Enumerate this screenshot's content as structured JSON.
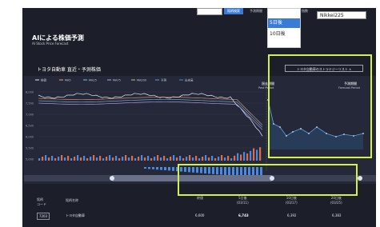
{
  "header": {
    "search_button": "銘柄検索",
    "nav_forecast": "予測期間",
    "nav_right": "指数",
    "ticker_value": "Nikkei225"
  },
  "dropdown": {
    "items": [
      "5日後",
      "10日後"
    ],
    "selected": "5日後"
  },
  "page": {
    "title": "AIによる株価予測",
    "subtitle": "AI Stock Price Forecast",
    "section_title": "トヨタ自動車 直近・予測株価",
    "strategy_button": "トヨタ自動車のストラテジーリスト ∧"
  },
  "chart_data": {
    "type": "line",
    "legend": [
      "株価",
      "MA5",
      "MA25",
      "MA75",
      "MA200",
      "予測",
      "出来高"
    ],
    "y_ticks": [
      "8,000",
      "7,500",
      "7,000",
      "6,500",
      "6,000",
      "5,500",
      "5,000"
    ],
    "past_label": "過去期間",
    "past_label_en": "Past Period",
    "forecast_label": "予測期間",
    "forecast_label_en": "Forecast Period",
    "colors": {
      "price": "#e8eef9",
      "ma1": "#f0a070",
      "ma2": "#70c0f0",
      "ma3": "#c0a0f0",
      "forecast": "#5aa0e0",
      "up": "#e06a4a",
      "down": "#4a8ae0"
    }
  },
  "table": {
    "headers": [
      "銘柄\nコード",
      "銘柄名称",
      "終値",
      "5日後\n(03/11)",
      "10日後\n(03/17)",
      "20日後\n(03/25)"
    ],
    "rows": [
      {
        "code": "7203",
        "name": "トヨタ自動車",
        "close": "6,600",
        "d5": "6,743",
        "d10": "6,392",
        "d20": "6,383"
      }
    ]
  }
}
